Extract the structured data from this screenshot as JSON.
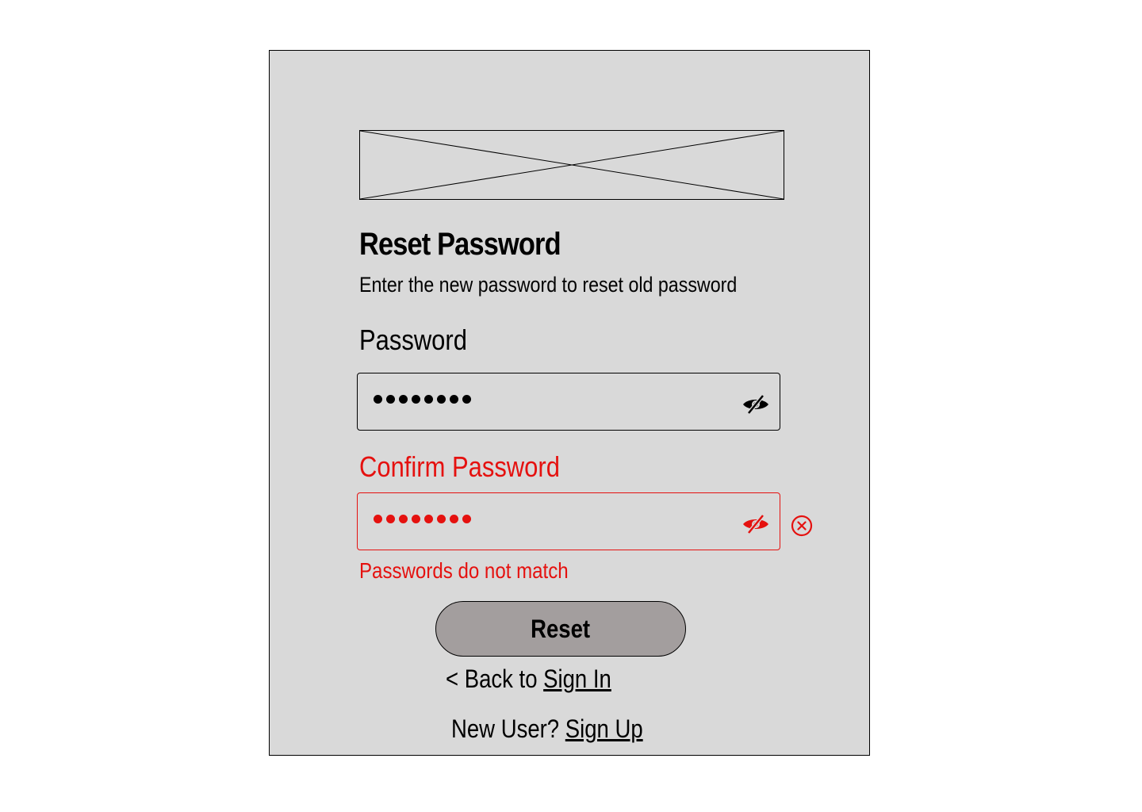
{
  "form": {
    "title": "Reset Password",
    "subtitle": "Enter the new password to reset old password"
  },
  "password": {
    "label": "Password",
    "masked_length": 8,
    "icon": "eye-slash-icon",
    "color": "#000000"
  },
  "confirm_password": {
    "label": "Confirm Password",
    "masked_length": 8,
    "icon": "eye-slash-icon",
    "clear_icon": "circle-x-icon",
    "color": "#e5110f",
    "error": "Passwords do not match"
  },
  "actions": {
    "reset_label": "Reset",
    "back_prefix": "< Back to ",
    "back_link": "Sign In",
    "new_user_prefix": "New User? ",
    "signup_link": "Sign Up"
  },
  "colors": {
    "background": "#d9d9d9",
    "button": "#a39e9e",
    "error": "#e5110f"
  }
}
